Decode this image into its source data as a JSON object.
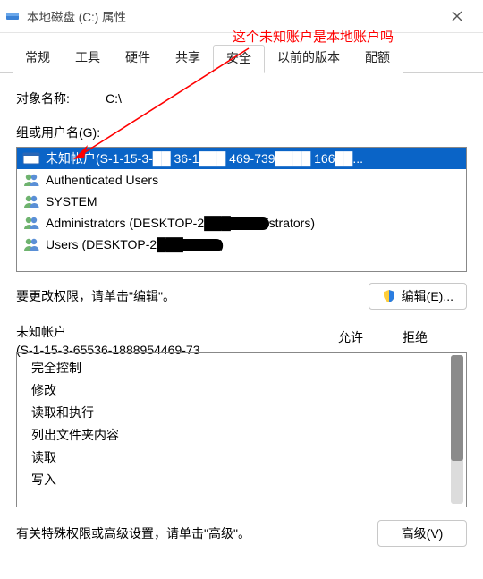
{
  "window": {
    "title": "本地磁盘 (C:) 属性"
  },
  "annotation": {
    "text": "这个未知账户是本地账户吗"
  },
  "tabs": {
    "t0": "常规",
    "t1": "工具",
    "t2": "硬件",
    "t3": "共享",
    "t4": "安全",
    "t5": "以前的版本",
    "t6": "配额"
  },
  "object": {
    "label": "对象名称:",
    "value": "C:\\"
  },
  "groups": {
    "label": "组或用户名(G):",
    "items": {
      "i0": "未知帐户(S-1-15-3-██ 36-1███ 469-739████ 166██...",
      "i1": "Authenticated Users",
      "i2": "SYSTEM",
      "i3": "Administrators (DESKTOP-2███Administrators)",
      "i4": "Users (DESKTOP-2███\\Users)"
    }
  },
  "editHint": "要更改权限，请单击\"编辑\"。",
  "editBtn": "编辑(E)...",
  "perm": {
    "titleA": "未知帐户",
    "titleB": "(S-1-15-3-65536-1888954469-73",
    "allow": "允许",
    "deny": "拒绝",
    "rows": {
      "r0": "完全控制",
      "r1": "修改",
      "r2": "读取和执行",
      "r3": "列出文件夹内容",
      "r4": "读取",
      "r5": "写入"
    }
  },
  "advHint": "有关特殊权限或高级设置，请单击\"高级\"。",
  "advBtn": "高级(V)"
}
